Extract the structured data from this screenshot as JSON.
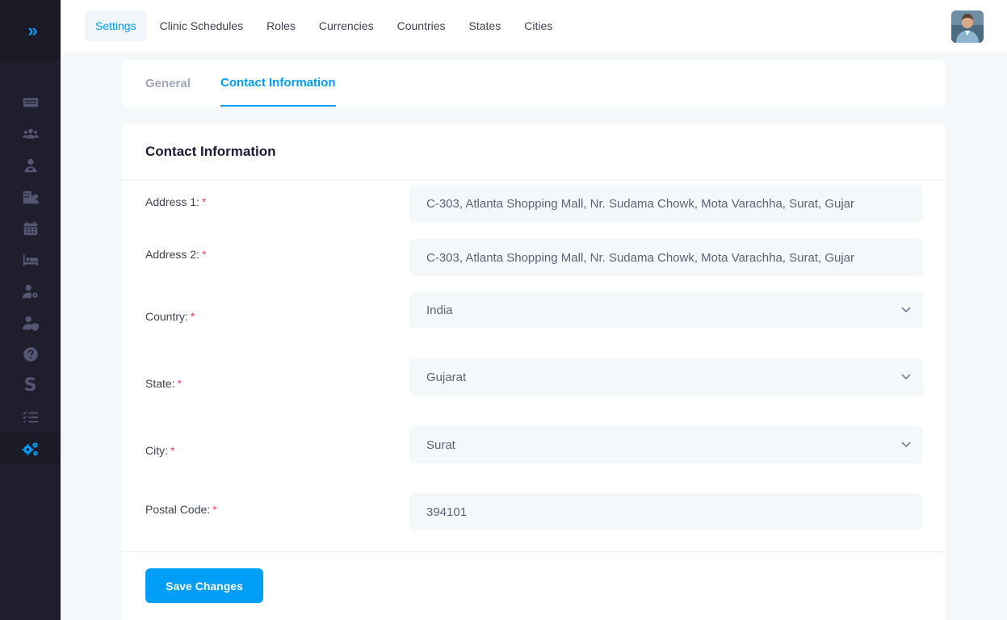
{
  "sidebar": {
    "brand_toggle": "»",
    "items": [
      {
        "icon": "id-card-icon"
      },
      {
        "icon": "users-icon"
      },
      {
        "icon": "doctor-icon"
      },
      {
        "icon": "hospital-icon"
      },
      {
        "icon": "calendar-icon"
      },
      {
        "icon": "bed-icon"
      },
      {
        "icon": "user-gear-icon"
      },
      {
        "icon": "user-shield-icon"
      },
      {
        "icon": "question-circle-icon"
      },
      {
        "icon": "s-letter-icon",
        "glyph": "S"
      },
      {
        "icon": "list-check-icon"
      },
      {
        "icon": "cogs-icon",
        "active": true
      }
    ]
  },
  "header": {
    "tabs": [
      "Settings",
      "Clinic Schedules",
      "Roles",
      "Currencies",
      "Countries",
      "States",
      "Cities"
    ],
    "active_tab": "Settings"
  },
  "subnav": {
    "general": "General",
    "contact": "Contact Information"
  },
  "form": {
    "title": "Contact Information",
    "address1": {
      "label": "Address 1:",
      "value": "C-303, Atlanta Shopping Mall, Nr. Sudama Chowk, Mota Varachha, Surat, Gujar"
    },
    "address2": {
      "label": "Address 2:",
      "value": "C-303, Atlanta Shopping Mall, Nr. Sudama Chowk, Mota Varachha, Surat, Gujar"
    },
    "country": {
      "label": "Country:",
      "value": "India"
    },
    "state": {
      "label": "State:",
      "value": "Gujarat"
    },
    "city": {
      "label": "City:",
      "value": "Surat"
    },
    "postal": {
      "label": "Postal Code:",
      "value": "394101"
    },
    "required_mark": "*",
    "save": "Save Changes"
  },
  "colors": {
    "accent": "#009ef7",
    "sidebar_bg": "#1e1e2d",
    "required": "#f1416c"
  }
}
